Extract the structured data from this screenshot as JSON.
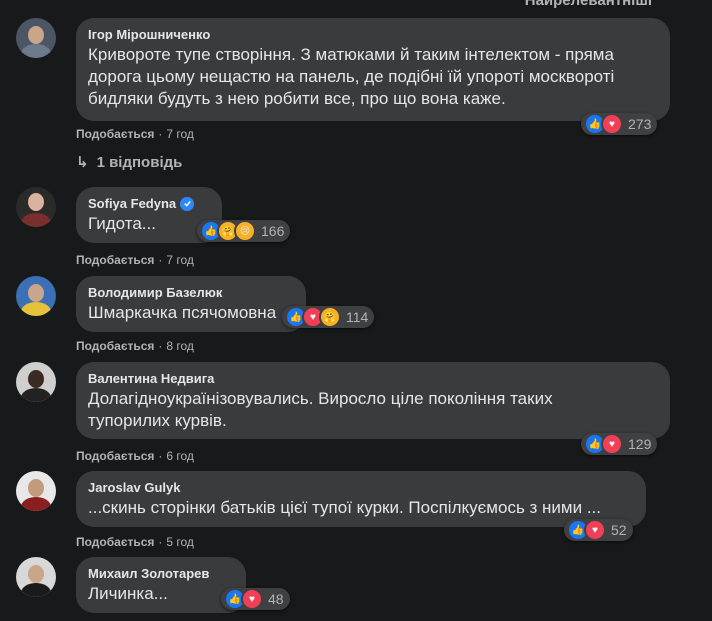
{
  "top_partial_label": "Найрелевантніші",
  "like_label": "Подобається",
  "comments": [
    {
      "author": "Ігор Мірошниченко",
      "verified": false,
      "text": "Кривороте тупе створіння. З матюками й таким інтелектом - пряма дорога цьому нещастю на панель, де подібні їй упороті москвороті бидляки будуть з нею робити все, про що вона каже.",
      "time": "7 год",
      "reactions": [
        "like-icon",
        "love-icon"
      ],
      "reaction_count": "273",
      "replies": "1 відповідь"
    },
    {
      "author": "Sofiya Fedyna",
      "verified": true,
      "text": "Гидота...",
      "time": "7 год",
      "reactions": [
        "like-icon",
        "care-icon",
        "sad-icon"
      ],
      "reaction_count": "166"
    },
    {
      "author": "Володимир Базелюк",
      "verified": false,
      "text": "Шмаркачка псячомовна",
      "time": "8 год",
      "reactions": [
        "like-icon",
        "love-icon",
        "care-icon"
      ],
      "reaction_count": "114"
    },
    {
      "author": "Валентина Недвига",
      "verified": false,
      "text": "Долагідноукраїнізовувались. Виросло ціле покоління таких тупорилих курвів.",
      "time": "6 год",
      "reactions": [
        "like-icon",
        "love-icon"
      ],
      "reaction_count": "129"
    },
    {
      "author": "Jaroslav Gulyk",
      "verified": false,
      "text": "...скинь сторінки батьків цієї тупої курки. Поспілкуємось з ними ...",
      "time": "5 год",
      "reactions": [
        "like-icon",
        "love-icon"
      ],
      "reaction_count": "52"
    },
    {
      "author": "Михаил Золотарев",
      "verified": false,
      "text": "Личинка...",
      "time": "",
      "reactions": [
        "like-icon",
        "love-icon"
      ],
      "reaction_count": "48"
    }
  ]
}
